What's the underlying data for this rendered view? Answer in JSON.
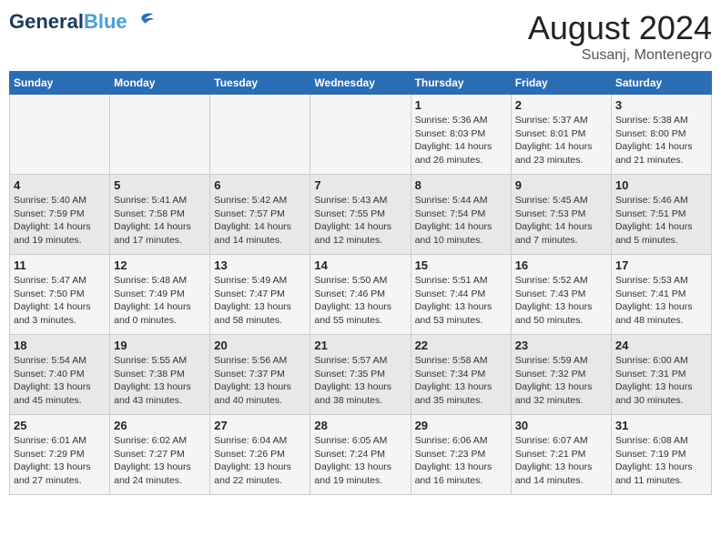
{
  "header": {
    "logo_line1": "General",
    "logo_line2": "Blue",
    "title": "August 2024",
    "subtitle": "Susanj, Montenegro"
  },
  "weekdays": [
    "Sunday",
    "Monday",
    "Tuesday",
    "Wednesday",
    "Thursday",
    "Friday",
    "Saturday"
  ],
  "weeks": [
    [
      {
        "day": "",
        "text": ""
      },
      {
        "day": "",
        "text": ""
      },
      {
        "day": "",
        "text": ""
      },
      {
        "day": "",
        "text": ""
      },
      {
        "day": "1",
        "text": "Sunrise: 5:36 AM\nSunset: 8:03 PM\nDaylight: 14 hours and 26 minutes."
      },
      {
        "day": "2",
        "text": "Sunrise: 5:37 AM\nSunset: 8:01 PM\nDaylight: 14 hours and 23 minutes."
      },
      {
        "day": "3",
        "text": "Sunrise: 5:38 AM\nSunset: 8:00 PM\nDaylight: 14 hours and 21 minutes."
      }
    ],
    [
      {
        "day": "4",
        "text": "Sunrise: 5:40 AM\nSunset: 7:59 PM\nDaylight: 14 hours and 19 minutes."
      },
      {
        "day": "5",
        "text": "Sunrise: 5:41 AM\nSunset: 7:58 PM\nDaylight: 14 hours and 17 minutes."
      },
      {
        "day": "6",
        "text": "Sunrise: 5:42 AM\nSunset: 7:57 PM\nDaylight: 14 hours and 14 minutes."
      },
      {
        "day": "7",
        "text": "Sunrise: 5:43 AM\nSunset: 7:55 PM\nDaylight: 14 hours and 12 minutes."
      },
      {
        "day": "8",
        "text": "Sunrise: 5:44 AM\nSunset: 7:54 PM\nDaylight: 14 hours and 10 minutes."
      },
      {
        "day": "9",
        "text": "Sunrise: 5:45 AM\nSunset: 7:53 PM\nDaylight: 14 hours and 7 minutes."
      },
      {
        "day": "10",
        "text": "Sunrise: 5:46 AM\nSunset: 7:51 PM\nDaylight: 14 hours and 5 minutes."
      }
    ],
    [
      {
        "day": "11",
        "text": "Sunrise: 5:47 AM\nSunset: 7:50 PM\nDaylight: 14 hours and 3 minutes."
      },
      {
        "day": "12",
        "text": "Sunrise: 5:48 AM\nSunset: 7:49 PM\nDaylight: 14 hours and 0 minutes."
      },
      {
        "day": "13",
        "text": "Sunrise: 5:49 AM\nSunset: 7:47 PM\nDaylight: 13 hours and 58 minutes."
      },
      {
        "day": "14",
        "text": "Sunrise: 5:50 AM\nSunset: 7:46 PM\nDaylight: 13 hours and 55 minutes."
      },
      {
        "day": "15",
        "text": "Sunrise: 5:51 AM\nSunset: 7:44 PM\nDaylight: 13 hours and 53 minutes."
      },
      {
        "day": "16",
        "text": "Sunrise: 5:52 AM\nSunset: 7:43 PM\nDaylight: 13 hours and 50 minutes."
      },
      {
        "day": "17",
        "text": "Sunrise: 5:53 AM\nSunset: 7:41 PM\nDaylight: 13 hours and 48 minutes."
      }
    ],
    [
      {
        "day": "18",
        "text": "Sunrise: 5:54 AM\nSunset: 7:40 PM\nDaylight: 13 hours and 45 minutes."
      },
      {
        "day": "19",
        "text": "Sunrise: 5:55 AM\nSunset: 7:38 PM\nDaylight: 13 hours and 43 minutes."
      },
      {
        "day": "20",
        "text": "Sunrise: 5:56 AM\nSunset: 7:37 PM\nDaylight: 13 hours and 40 minutes."
      },
      {
        "day": "21",
        "text": "Sunrise: 5:57 AM\nSunset: 7:35 PM\nDaylight: 13 hours and 38 minutes."
      },
      {
        "day": "22",
        "text": "Sunrise: 5:58 AM\nSunset: 7:34 PM\nDaylight: 13 hours and 35 minutes."
      },
      {
        "day": "23",
        "text": "Sunrise: 5:59 AM\nSunset: 7:32 PM\nDaylight: 13 hours and 32 minutes."
      },
      {
        "day": "24",
        "text": "Sunrise: 6:00 AM\nSunset: 7:31 PM\nDaylight: 13 hours and 30 minutes."
      }
    ],
    [
      {
        "day": "25",
        "text": "Sunrise: 6:01 AM\nSunset: 7:29 PM\nDaylight: 13 hours and 27 minutes."
      },
      {
        "day": "26",
        "text": "Sunrise: 6:02 AM\nSunset: 7:27 PM\nDaylight: 13 hours and 24 minutes."
      },
      {
        "day": "27",
        "text": "Sunrise: 6:04 AM\nSunset: 7:26 PM\nDaylight: 13 hours and 22 minutes."
      },
      {
        "day": "28",
        "text": "Sunrise: 6:05 AM\nSunset: 7:24 PM\nDaylight: 13 hours and 19 minutes."
      },
      {
        "day": "29",
        "text": "Sunrise: 6:06 AM\nSunset: 7:23 PM\nDaylight: 13 hours and 16 minutes."
      },
      {
        "day": "30",
        "text": "Sunrise: 6:07 AM\nSunset: 7:21 PM\nDaylight: 13 hours and 14 minutes."
      },
      {
        "day": "31",
        "text": "Sunrise: 6:08 AM\nSunset: 7:19 PM\nDaylight: 13 hours and 11 minutes."
      }
    ]
  ]
}
